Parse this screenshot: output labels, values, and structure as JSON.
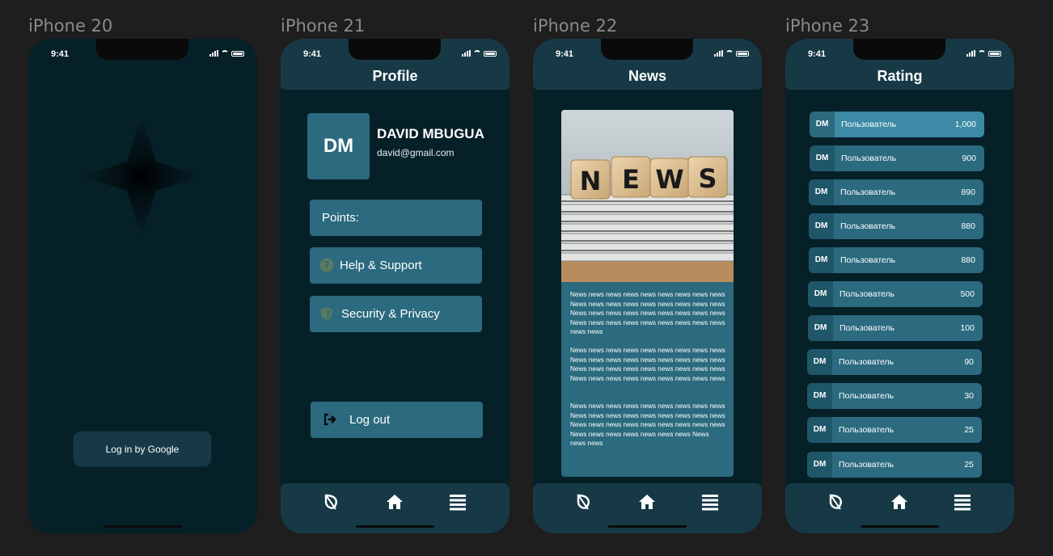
{
  "status_time": "9:41",
  "frames": [
    "iPhone 20",
    "iPhone 21",
    "iPhone 22",
    "iPhone 23"
  ],
  "login": {
    "google_button": "Log in by Google"
  },
  "profile": {
    "title": "Profile",
    "avatar_initials": "DM",
    "name": "DAVID MBUGUA",
    "email": "david@gmail.com",
    "points_label": "Points:",
    "help_label": "Help & Support",
    "security_label": "Security & Privacy",
    "logout_label": "Log out"
  },
  "news": {
    "title": "News",
    "image_words": [
      "N",
      "E",
      "W",
      "S"
    ],
    "paragraphs": [
      "News news news news news news news news news News news news news news news news news news News news news news news news news news news News news news news news news news news news news news",
      "News news news news news news news news news News news news news news news news news news News news news news news news news news news News news news news news news news news news",
      "News news news news news news news news news News news news news news news news news news News news news news news news news news news News news news news news news news News news news"
    ]
  },
  "rating": {
    "title": "Rating",
    "rows": [
      {
        "initials": "DM",
        "name": "Пользователь",
        "score": "1,000"
      },
      {
        "initials": "DM",
        "name": "Пользователь",
        "score": "900"
      },
      {
        "initials": "DM",
        "name": "Пользователь",
        "score": "890"
      },
      {
        "initials": "DM",
        "name": "Пользователь",
        "score": "880"
      },
      {
        "initials": "DM",
        "name": "Пользователь",
        "score": "880"
      },
      {
        "initials": "DM",
        "name": "Пользователь",
        "score": "500"
      },
      {
        "initials": "DM",
        "name": "Пользователь",
        "score": "100"
      },
      {
        "initials": "DM",
        "name": "Пользователь",
        "score": "90"
      },
      {
        "initials": "DM",
        "name": "Пользователь",
        "score": "30"
      },
      {
        "initials": "DM",
        "name": "Пользователь",
        "score": "25"
      },
      {
        "initials": "DM",
        "name": "Пользователь",
        "score": "25"
      }
    ]
  },
  "tab_icons": [
    "leaf-icon",
    "home-icon",
    "menu-icon"
  ],
  "colors": {
    "background": "#062028",
    "panel": "#173946",
    "accent": "#2b6a7f",
    "highlight": "#3d8aa6"
  }
}
